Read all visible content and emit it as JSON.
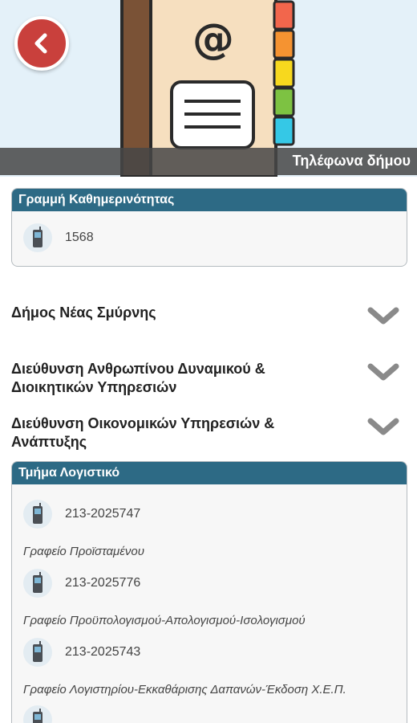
{
  "header": {
    "title": "Τηλέφωνα δήμου",
    "back_icon": "chevron-left-icon",
    "illustration": "address-book-icon",
    "back_color": "#c9403c"
  },
  "accent_color": "#2d6a85",
  "daily_line": {
    "title": "Γραμμή Καθημερινότητας",
    "phone": "1568"
  },
  "sections": [
    {
      "title": "Δήμος Νέας Σμύρνης",
      "icon": "chevron-down-icon"
    },
    {
      "title": "Διεύθυνση Ανθρωπίνου Δυναμικού & Διοικητικών Υπηρεσιών",
      "icon": "chevron-down-icon"
    },
    {
      "title": "Διεύθυνση Οικονομικών Υπηρεσιών & Ανάπτυξης",
      "icon": "chevron-down-icon"
    }
  ],
  "accounting": {
    "title": "Τμήμα Λογιστικό",
    "entries": [
      {
        "phone": "213-2025747",
        "label": "Γραφείο Προϊσταμένου"
      },
      {
        "phone": "213-2025776",
        "label": "Γραφείο Προϋπολογισμού-Απολογισμού-Ισολογισμού"
      },
      {
        "phone": "213-2025743",
        "label": "Γραφείο Λογιστηρίου-Εκκαθάρισης Δαπανών-Έκδοση Χ.Ε.Π."
      }
    ]
  }
}
